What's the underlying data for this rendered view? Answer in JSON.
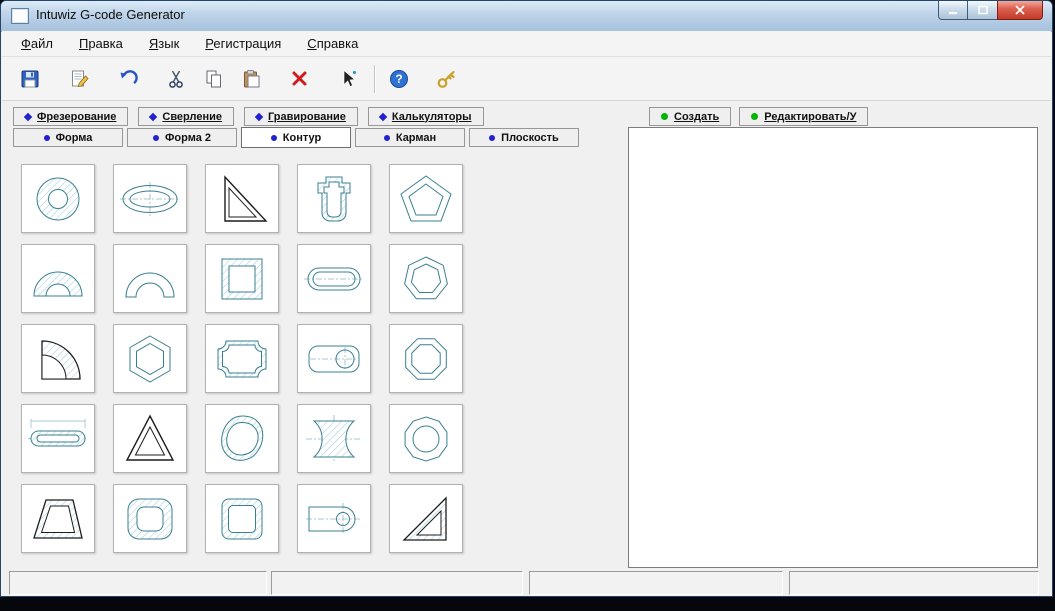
{
  "window": {
    "title": "Intuwiz G-code Generator",
    "controls": {
      "minimize": "minimize",
      "maximize": "maximize",
      "close": "close"
    }
  },
  "menu": {
    "items": [
      {
        "id": "file",
        "label": "Файл"
      },
      {
        "id": "edit",
        "label": "Правка"
      },
      {
        "id": "language",
        "label": "Язык"
      },
      {
        "id": "registration",
        "label": "Регистрация"
      },
      {
        "id": "help",
        "label": "Справка"
      }
    ]
  },
  "toolbar": {
    "items": [
      {
        "id": "save",
        "icon": "save-icon"
      },
      {
        "id": "edit",
        "icon": "edit-icon"
      },
      {
        "id": "undo",
        "icon": "undo-icon"
      },
      {
        "id": "cut",
        "icon": "cut-icon"
      },
      {
        "id": "copy",
        "icon": "copy-icon"
      },
      {
        "id": "paste",
        "icon": "paste-icon"
      },
      {
        "id": "delete",
        "icon": "delete-icon"
      },
      {
        "id": "pointer",
        "icon": "pointer-icon"
      },
      {
        "id": "separator",
        "type": "separator"
      },
      {
        "id": "help",
        "icon": "help-icon"
      },
      {
        "id": "key",
        "icon": "key-icon"
      }
    ]
  },
  "tabs": {
    "primary": [
      {
        "id": "milling",
        "label": "Фрезерование",
        "marker": "blue-diamond"
      },
      {
        "id": "drilling",
        "label": "Сверление",
        "marker": "blue-diamond"
      },
      {
        "id": "engraving",
        "label": "Гравирование",
        "marker": "blue-diamond"
      },
      {
        "id": "calculators",
        "label": "Калькуляторы",
        "marker": "blue-diamond"
      }
    ],
    "right": [
      {
        "id": "create",
        "label": "Создать",
        "marker": "green-dot"
      },
      {
        "id": "edit-delete",
        "label": "Редактировать/У",
        "marker": "green-dot"
      }
    ],
    "secondary": [
      {
        "id": "shape",
        "label": "Форма",
        "marker": "blue-dot",
        "active": false
      },
      {
        "id": "shape-2",
        "label": "Форма 2",
        "marker": "blue-dot",
        "active": false
      },
      {
        "id": "contour",
        "label": "Контур",
        "marker": "blue-dot",
        "active": true
      },
      {
        "id": "pocket",
        "label": "Карман",
        "marker": "blue-dot",
        "active": false
      },
      {
        "id": "plane",
        "label": "Плоскость",
        "marker": "blue-dot",
        "active": false
      }
    ]
  },
  "shapes": {
    "items": [
      {
        "id": "ring"
      },
      {
        "id": "ellipse"
      },
      {
        "id": "right-triangle"
      },
      {
        "id": "tabbed-plate"
      },
      {
        "id": "pentagon"
      },
      {
        "id": "half-ring"
      },
      {
        "id": "arch"
      },
      {
        "id": "square-frame"
      },
      {
        "id": "oval-slot"
      },
      {
        "id": "heptagon"
      },
      {
        "id": "quarter-ring"
      },
      {
        "id": "hexagon"
      },
      {
        "id": "plaque"
      },
      {
        "id": "rounded-slot"
      },
      {
        "id": "octagon"
      },
      {
        "id": "thin-slot"
      },
      {
        "id": "triangle"
      },
      {
        "id": "blob"
      },
      {
        "id": "spool"
      },
      {
        "id": "decagon"
      },
      {
        "id": "trapezoid"
      },
      {
        "id": "rounded-frame"
      },
      {
        "id": "rounded-square"
      },
      {
        "id": "keyhole-slot"
      },
      {
        "id": "right-triangle-2"
      }
    ]
  },
  "preview": {
    "content": ""
  },
  "statusbar": {
    "panels": [
      "",
      "",
      "",
      ""
    ]
  },
  "colors": {
    "titlebar_top": "#dcebf7",
    "titlebar_bottom": "#a6c1dc",
    "close_button": "#c23a28",
    "accent_blue": "#2121d0",
    "accent_green": "#00b400",
    "drawing_teal": "#3a7f91",
    "drawing_black": "#1c1c1c",
    "hatch_blue": "#a9d3e5",
    "window_bg": "#f0f0f0"
  }
}
